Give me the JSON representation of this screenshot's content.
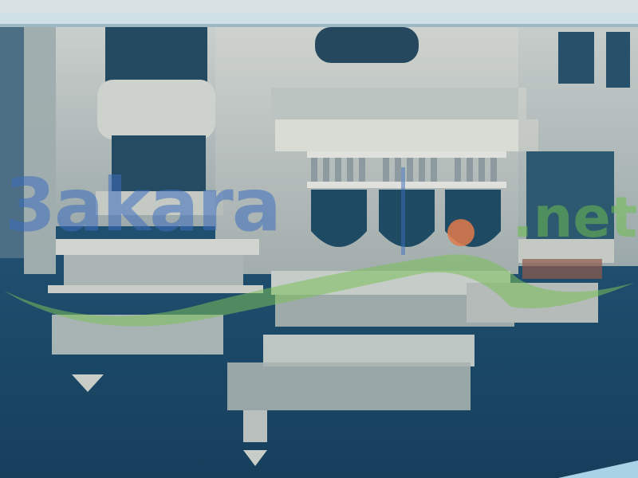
{
  "photo": {
    "description_icon": "pool-reflection-photo",
    "water_color": "#1f4e6e",
    "building_color": "#c9cdc8",
    "pool_edge_color": "#cfe0e6"
  },
  "watermark": {
    "left_text": "3akara",
    "right_text": ".net",
    "left_color": "#3c6ebe",
    "right_color": "#6ebe50",
    "dot_color": "#e07a4a",
    "wave_color": "#7ac05a"
  }
}
